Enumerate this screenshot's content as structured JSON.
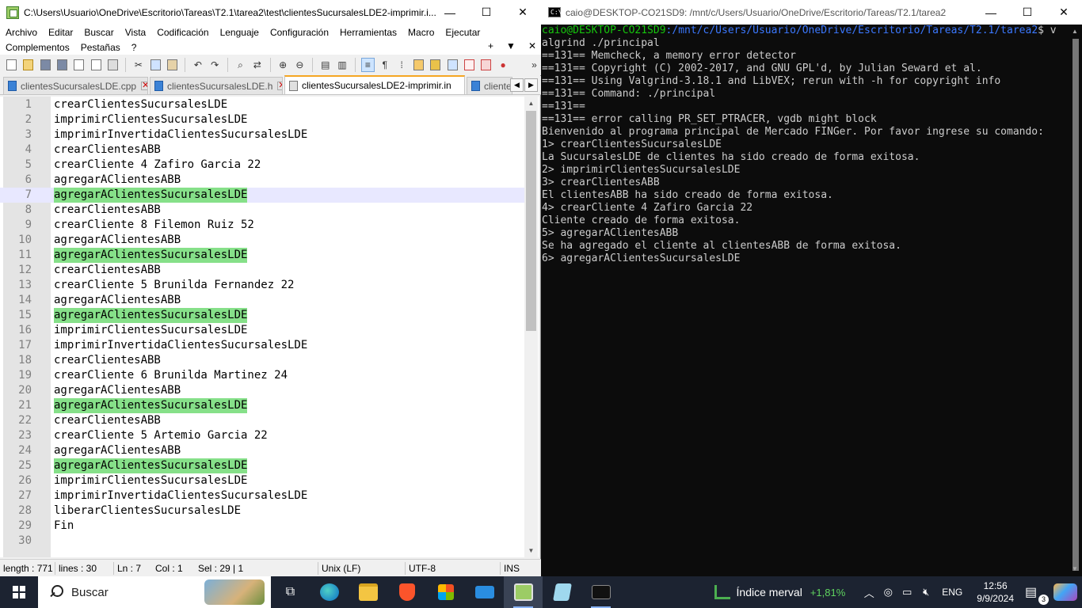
{
  "npp": {
    "title": "C:\\Users\\Usuario\\OneDrive\\Escritorio\\Tareas\\T2.1\\tarea2\\test\\clientesSucursalesLDE2-imprimir.i...",
    "menu_row1": [
      "Archivo",
      "Editar",
      "Buscar",
      "Vista",
      "Codificación",
      "Lenguaje",
      "Configuración",
      "Herramientas",
      "Macro",
      "Ejecutar"
    ],
    "menu_row2": [
      "Complementos",
      "Pestañas",
      "?"
    ],
    "menu_right": [
      "+",
      "▼",
      "✕"
    ],
    "tabs": [
      {
        "label": "clientesSucursalesLDE.cpp",
        "active": false
      },
      {
        "label": "clientesSucursalesLDE.h",
        "active": false
      },
      {
        "label": "clientesSucursalesLDE2-imprimir.in",
        "active": true
      },
      {
        "label": "cliente",
        "active": false
      }
    ],
    "lines": [
      {
        "n": "1",
        "t": "crearClientesSucursalesLDE",
        "hl": false
      },
      {
        "n": "2",
        "t": "imprimirClientesSucursalesLDE",
        "hl": false
      },
      {
        "n": "3",
        "t": "imprimirInvertidaClientesSucursalesLDE",
        "hl": false
      },
      {
        "n": "4",
        "t": "crearClientesABB",
        "hl": false
      },
      {
        "n": "5",
        "t": "crearCliente 4 Zafiro Garcia 22",
        "hl": false
      },
      {
        "n": "6",
        "t": "agregarAClientesABB",
        "hl": false
      },
      {
        "n": "7",
        "t": "agregarAClientesSucursalesLDE",
        "hl": true
      },
      {
        "n": "8",
        "t": "crearClientesABB",
        "hl": false
      },
      {
        "n": "9",
        "t": "crearCliente 8 Filemon Ruiz 52",
        "hl": false
      },
      {
        "n": "10",
        "t": "agregarAClientesABB",
        "hl": false
      },
      {
        "n": "11",
        "t": "agregarAClientesSucursalesLDE",
        "hl": true
      },
      {
        "n": "12",
        "t": "crearClientesABB",
        "hl": false
      },
      {
        "n": "13",
        "t": "crearCliente 5 Brunilda Fernandez 22",
        "hl": false
      },
      {
        "n": "14",
        "t": "agregarAClientesABB",
        "hl": false
      },
      {
        "n": "15",
        "t": "agregarAClientesSucursalesLDE",
        "hl": true
      },
      {
        "n": "16",
        "t": "imprimirClientesSucursalesLDE",
        "hl": false
      },
      {
        "n": "17",
        "t": "imprimirInvertidaClientesSucursalesLDE",
        "hl": false
      },
      {
        "n": "18",
        "t": "crearClientesABB",
        "hl": false
      },
      {
        "n": "19",
        "t": "crearCliente 6 Brunilda Martinez 24",
        "hl": false
      },
      {
        "n": "20",
        "t": "agregarAClientesABB",
        "hl": false
      },
      {
        "n": "21",
        "t": "agregarAClientesSucursalesLDE",
        "hl": true
      },
      {
        "n": "22",
        "t": "crearClientesABB",
        "hl": false
      },
      {
        "n": "23",
        "t": "crearCliente 5 Artemio Garcia 22",
        "hl": false
      },
      {
        "n": "24",
        "t": "agregarAClientesABB",
        "hl": false
      },
      {
        "n": "25",
        "t": "agregarAClientesSucursalesLDE",
        "hl": true
      },
      {
        "n": "26",
        "t": "imprimirClientesSucursalesLDE",
        "hl": false
      },
      {
        "n": "27",
        "t": "imprimirInvertidaClientesSucursalesLDE",
        "hl": false
      },
      {
        "n": "28",
        "t": "liberarClientesSucursalesLDE",
        "hl": false
      },
      {
        "n": "29",
        "t": "Fin",
        "hl": false
      },
      {
        "n": "30",
        "t": "",
        "hl": false
      }
    ],
    "current_line": "7",
    "status": {
      "length": "length : 771",
      "lines": "lines : 30",
      "ln": "Ln : 7",
      "col": "Col : 1",
      "sel": "Sel : 29 | 1",
      "eol": "Unix (LF)",
      "encoding": "UTF-8",
      "mode": "INS"
    }
  },
  "terminal": {
    "title": "caio@DESKTOP-CO21SD9: /mnt/c/Users/Usuario/OneDrive/Escritorio/Tareas/T2.1/tarea2",
    "prompt_user": "caio@DESKTOP-CO21SD9",
    "prompt_path": ":/mnt/c/Users/Usuario/OneDrive/Escritorio/Tareas/T2.1/tarea2",
    "prompt_end": "$ v",
    "lines": [
      "algrind ./principal",
      "==131== Memcheck, a memory error detector",
      "==131== Copyright (C) 2002-2017, and GNU GPL'd, by Julian Seward et al.",
      "==131== Using Valgrind-3.18.1 and LibVEX; rerun with -h for copyright info",
      "==131== Command: ./principal",
      "==131==",
      "==131== error calling PR_SET_PTRACER, vgdb might block",
      "Bienvenido al programa principal de Mercado FINGer. Por favor ingrese su comando:",
      "1> crearClientesSucursalesLDE",
      "La SucursalesLDE de clientes ha sido creado de forma exitosa.",
      "2> imprimirClientesSucursalesLDE",
      "3> crearClientesABB",
      "El clientesABB ha sido creado de forma exitosa.",
      "4> crearCliente 4 Zafiro Garcia 22",
      "Cliente creado de forma exitosa.",
      "5> agregarAClientesABB",
      "Se ha agregado el cliente al clientesABB de forma exitosa.",
      "6> agregarAClientesSucursalesLDE"
    ]
  },
  "taskbar": {
    "search_placeholder": "Buscar",
    "weather_label": "Índice merval",
    "weather_value": "+1,81%",
    "lang": "ENG",
    "time": "12:56",
    "date": "9/9/2024",
    "notif_count": "3"
  }
}
